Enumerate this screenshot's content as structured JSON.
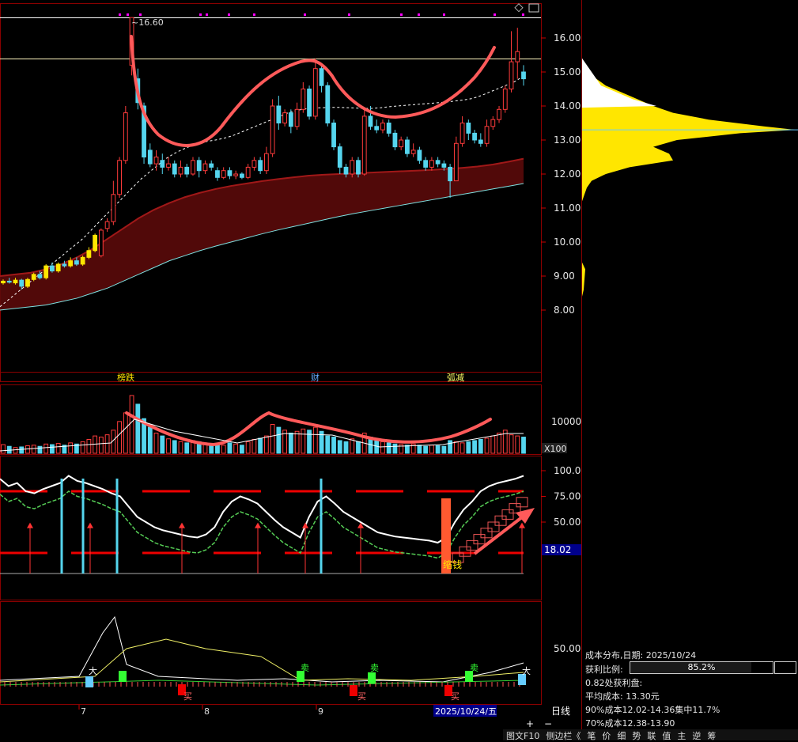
{
  "colors": {
    "up": "#ff3b3b",
    "down": "#55d5ee",
    "yellow": "#ffe600",
    "grid": "#7a0000",
    "curve": "#ff5a5a"
  },
  "price_axis": {
    "ticks": [
      "16.00",
      "15.00",
      "14.00",
      "13.00",
      "12.00",
      "11.00",
      "10.00",
      "9.00",
      "8.00"
    ]
  },
  "volume_axis": {
    "ticks": [
      "10000"
    ],
    "unit": "X100"
  },
  "ind_axis": {
    "ticks": [
      "100.0",
      "75.00",
      "50.00"
    ],
    "badge": "18.02"
  },
  "bot_axis": {
    "ticks": [
      "50.00"
    ]
  },
  "chart_labels": {
    "high": "16.60",
    "n1": "榜跌",
    "n2": "财",
    "n3": "弧减",
    "ind_note": "缩钱"
  },
  "signals": {
    "big": "大",
    "buy": "买",
    "sell": "卖"
  },
  "x_axis": {
    "months": [
      "7",
      "8",
      "9"
    ],
    "date_label": "2025/10/24/五",
    "period": "日线",
    "zoom_in": "+",
    "zoom_out": "−"
  },
  "cost": {
    "title": "成本分布,日期: 2025/10/24",
    "profit_label": "获利比例:",
    "profit_value": "85.2%",
    "profit_ratio": 0.852,
    "line3": "0.82处获利盘:",
    "line4": "平均成本: 13.30元",
    "line5": "90%成本12.02-14.36集中11.7%",
    "line6": "70%成本12.38-13.90"
  },
  "tabs": [
    "图文F10",
    "侧边栏《",
    "笔",
    "价",
    "细",
    "势",
    "联",
    "值",
    "主",
    "逆",
    "筹"
  ],
  "chart_data": {
    "type": "candlestick",
    "y_range": [
      7.5,
      16.8
    ],
    "candles": [
      [
        8.8,
        8.85,
        8.75,
        8.9
      ],
      [
        8.85,
        8.82,
        8.78,
        8.95
      ],
      [
        8.8,
        8.88,
        8.75,
        8.95
      ],
      [
        8.88,
        8.7,
        8.6,
        8.92
      ],
      [
        8.7,
        8.9,
        8.65,
        8.95
      ],
      [
        8.9,
        9.05,
        8.85,
        9.1
      ],
      [
        9.05,
        8.95,
        8.9,
        9.15
      ],
      [
        8.95,
        9.3,
        8.9,
        9.35
      ],
      [
        9.3,
        9.15,
        9.1,
        9.4
      ],
      [
        9.15,
        9.35,
        9.1,
        9.4
      ],
      [
        9.35,
        9.3,
        9.25,
        9.45
      ],
      [
        9.3,
        9.45,
        9.25,
        9.55
      ],
      [
        9.45,
        9.35,
        9.3,
        9.55
      ],
      [
        9.35,
        9.55,
        9.3,
        9.6
      ],
      [
        9.55,
        9.75,
        9.5,
        9.85
      ],
      [
        9.75,
        10.2,
        9.7,
        10.25
      ],
      [
        9.6,
        10.35,
        9.55,
        10.4
      ],
      [
        10.4,
        10.6,
        10.3,
        10.7
      ],
      [
        10.6,
        11.4,
        10.5,
        11.8
      ],
      [
        11.4,
        12.4,
        11.3,
        12.5
      ],
      [
        12.4,
        13.8,
        12.3,
        14.0
      ],
      [
        15.2,
        16.6,
        14.9,
        16.6
      ],
      [
        14.8,
        14.1,
        13.9,
        15.1
      ],
      [
        14.0,
        12.5,
        12.3,
        14.1
      ],
      [
        12.7,
        12.3,
        12.2,
        12.9
      ],
      [
        12.3,
        12.5,
        12.1,
        12.7
      ],
      [
        12.4,
        12.2,
        12.0,
        12.6
      ],
      [
        12.2,
        12.3,
        12.1,
        12.5
      ],
      [
        12.3,
        12.0,
        11.9,
        12.4
      ],
      [
        12.0,
        12.2,
        11.9,
        12.4
      ],
      [
        12.2,
        12.0,
        11.9,
        12.3
      ],
      [
        12.0,
        12.4,
        11.95,
        12.5
      ],
      [
        12.4,
        12.1,
        11.9,
        12.5
      ],
      [
        12.1,
        12.3,
        12.0,
        12.4
      ],
      [
        12.3,
        12.2,
        12.1,
        12.4
      ],
      [
        12.1,
        11.9,
        11.8,
        12.2
      ],
      [
        11.9,
        12.1,
        11.85,
        12.2
      ],
      [
        12.1,
        11.95,
        11.85,
        12.2
      ],
      [
        11.95,
        12.0,
        11.85,
        12.1
      ],
      [
        12.0,
        11.9,
        11.85,
        12.05
      ],
      [
        11.9,
        12.2,
        11.85,
        12.3
      ],
      [
        12.2,
        12.4,
        12.1,
        12.5
      ],
      [
        12.4,
        12.1,
        12.0,
        12.5
      ],
      [
        12.1,
        12.6,
        12.0,
        12.8
      ],
      [
        12.6,
        14.0,
        12.5,
        14.2
      ],
      [
        14.0,
        13.5,
        13.3,
        14.3
      ],
      [
        13.5,
        13.8,
        13.4,
        13.9
      ],
      [
        13.8,
        13.4,
        13.2,
        13.9
      ],
      [
        13.4,
        13.9,
        13.3,
        14.1
      ],
      [
        13.9,
        14.5,
        13.8,
        14.7
      ],
      [
        14.5,
        13.7,
        13.6,
        14.6
      ],
      [
        13.7,
        15.1,
        13.6,
        15.4
      ],
      [
        15.1,
        14.6,
        14.4,
        15.2
      ],
      [
        14.6,
        13.5,
        13.4,
        14.7
      ],
      [
        13.5,
        12.8,
        12.7,
        13.6
      ],
      [
        12.8,
        12.2,
        12.0,
        12.9
      ],
      [
        12.2,
        12.0,
        11.9,
        12.3
      ],
      [
        12.0,
        12.4,
        11.9,
        12.5
      ],
      [
        12.4,
        12.0,
        11.9,
        12.5
      ],
      [
        12.0,
        13.7,
        11.95,
        13.9
      ],
      [
        13.7,
        13.4,
        13.3,
        14.0
      ],
      [
        13.4,
        13.3,
        13.2,
        13.6
      ],
      [
        13.3,
        13.5,
        13.2,
        13.6
      ],
      [
        13.5,
        13.2,
        13.1,
        13.6
      ],
      [
        13.2,
        12.8,
        12.7,
        13.3
      ],
      [
        12.8,
        13.0,
        12.7,
        13.1
      ],
      [
        13.0,
        12.6,
        12.5,
        13.1
      ],
      [
        12.6,
        12.7,
        12.5,
        12.9
      ],
      [
        12.7,
        12.4,
        12.3,
        12.8
      ],
      [
        12.4,
        12.2,
        12.1,
        12.5
      ],
      [
        12.2,
        12.4,
        12.1,
        12.5
      ],
      [
        12.4,
        12.3,
        12.2,
        12.5
      ],
      [
        12.3,
        12.2,
        12.1,
        12.4
      ],
      [
        12.2,
        11.8,
        11.3,
        12.3
      ],
      [
        11.8,
        12.9,
        11.8,
        13.1
      ],
      [
        12.9,
        13.5,
        12.8,
        13.7
      ],
      [
        13.5,
        13.2,
        13.0,
        13.6
      ],
      [
        13.2,
        13.0,
        12.9,
        13.3
      ],
      [
        13.0,
        12.9,
        12.8,
        13.2
      ],
      [
        12.9,
        13.4,
        12.8,
        13.6
      ],
      [
        13.4,
        13.6,
        13.3,
        13.7
      ],
      [
        13.6,
        13.9,
        13.5,
        14.0
      ],
      [
        13.9,
        14.5,
        13.8,
        14.6
      ],
      [
        14.5,
        15.3,
        14.4,
        16.2
      ],
      [
        15.3,
        15.6,
        14.8,
        16.3
      ],
      [
        15.0,
        14.8,
        14.6,
        15.2
      ]
    ],
    "ma_dashed": [
      8.1,
      8.3,
      8.5,
      8.7,
      8.9,
      9.1,
      9.3,
      9.5,
      9.7,
      9.9,
      10.1,
      10.35,
      10.6,
      10.85,
      11.1,
      11.35,
      11.6,
      11.85,
      12.05,
      12.25,
      12.45,
      12.6,
      12.72,
      12.82,
      12.9,
      12.96,
      13.0,
      13.05,
      13.12,
      13.22,
      13.32,
      13.42,
      13.52,
      13.62,
      13.72,
      13.82,
      13.88,
      13.92,
      13.94,
      13.95,
      13.96,
      13.96,
      13.95,
      13.94,
      13.93,
      13.93,
      13.95,
      13.98,
      14.0,
      14.02,
      14.04,
      14.06,
      14.08,
      14.1,
      14.12,
      14.15,
      14.18,
      14.22,
      14.3,
      14.4,
      14.5,
      14.6,
      14.7,
      14.85
    ],
    "band_upper": [
      9.0,
      9.05,
      9.1,
      9.2,
      9.35,
      9.55,
      9.8,
      10.1,
      10.4,
      10.7,
      10.95,
      11.15,
      11.32,
      11.45,
      11.56,
      11.65,
      11.72,
      11.79,
      11.85,
      11.9,
      11.95,
      11.98,
      12.0,
      12.02,
      12.04,
      12.06,
      12.08,
      12.1,
      12.12,
      12.15,
      12.18,
      12.22,
      12.28,
      12.36,
      12.45
    ],
    "band_lower": [
      8.0,
      8.05,
      8.1,
      8.15,
      8.25,
      8.35,
      8.5,
      8.65,
      8.85,
      9.05,
      9.25,
      9.45,
      9.6,
      9.75,
      9.88,
      10.0,
      10.12,
      10.24,
      10.35,
      10.45,
      10.55,
      10.65,
      10.75,
      10.84,
      10.92,
      11.0,
      11.08,
      11.16,
      11.24,
      11.32,
      11.4,
      11.48,
      11.56,
      11.64,
      11.72
    ],
    "volume": [
      15,
      12,
      10,
      11,
      13,
      14,
      12,
      16,
      15,
      17,
      14,
      18,
      16,
      20,
      24,
      30,
      28,
      32,
      40,
      55,
      70,
      100,
      85,
      60,
      45,
      35,
      30,
      25,
      22,
      20,
      18,
      22,
      20,
      18,
      16,
      15,
      14,
      18,
      16,
      14,
      20,
      24,
      26,
      30,
      50,
      45,
      40,
      35,
      38,
      42,
      40,
      45,
      38,
      30,
      28,
      22,
      20,
      25,
      20,
      35,
      28,
      22,
      20,
      18,
      16,
      15,
      14,
      16,
      14,
      12,
      14,
      13,
      12,
      22,
      20,
      18,
      20,
      22,
      24,
      26,
      30,
      35,
      40,
      32,
      30,
      28
    ],
    "indicator": [
      92,
      85,
      88,
      80,
      78,
      82,
      85,
      88,
      95,
      90,
      88,
      85,
      82,
      78,
      75,
      65,
      55,
      50,
      45,
      42,
      40,
      38,
      36,
      35,
      38,
      45,
      60,
      70,
      75,
      72,
      68,
      60,
      52,
      45,
      40,
      35,
      55,
      70,
      75,
      68,
      60,
      55,
      50,
      45,
      40,
      38,
      36,
      35,
      34,
      33,
      32,
      30,
      35,
      50,
      62,
      70,
      80,
      85,
      88,
      90,
      92,
      95
    ]
  }
}
